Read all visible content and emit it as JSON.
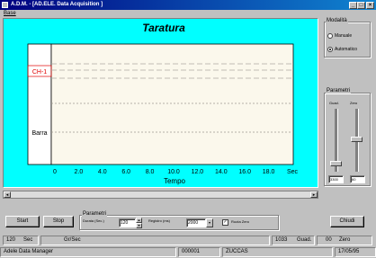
{
  "window": {
    "title": "A.D.M. - [AD.ELE. Data Acquisition ]"
  },
  "menu": {
    "items": [
      "Base"
    ]
  },
  "chart_data": {
    "type": "line",
    "title": "Taratura",
    "xlabel": "Tempo",
    "ylabel": "",
    "x_ticks": [
      "0",
      "2.0",
      "4.0",
      "6.0",
      "8.0",
      "10.0",
      "12.0",
      "14.0",
      "16.0",
      "18.0",
      "Sec"
    ],
    "xlim": [
      0,
      20
    ],
    "channel_labels": [
      "CH-1",
      "Barra"
    ],
    "series": []
  },
  "modalita": {
    "label": "Modalità",
    "options": [
      "Manuale",
      "Automatico"
    ],
    "selected": 1
  },
  "parametri": {
    "label": "Parametri",
    "slider_labels": [
      "Guad.",
      "Zero"
    ],
    "slider_values": [
      "3300",
      "60"
    ]
  },
  "bottom": {
    "start": "Start",
    "stop": "Stop",
    "chiudi": "Chiudi",
    "parametri_label": "Parametri",
    "durata_label": "Durata (Sec.)",
    "durata_value": "120",
    "registro_label": "Registro (ms)",
    "registro_value": "2000",
    "ruota_zero": "Ruota Zero",
    "ruota_zero_checked": true
  },
  "status1": {
    "time_value": "120",
    "time_unit": "Sec",
    "ch_label": "Gr/Sec",
    "guad_value": "1033",
    "guad_label": "Guad.",
    "zero_value": "00",
    "zero_label": "Zero"
  },
  "status2": {
    "app": "Adele Data Manager",
    "code": "000001",
    "name": "ZUCCAS",
    "date": "17/05/95"
  }
}
